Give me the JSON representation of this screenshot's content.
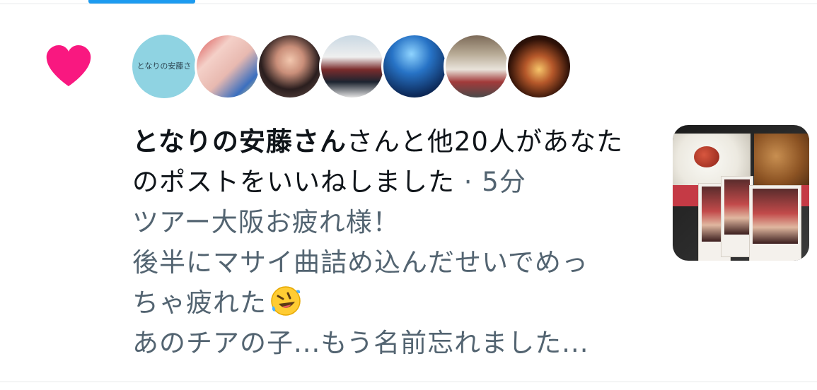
{
  "notification": {
    "name": "となりの安藤さん",
    "action_text": "さんと他20人があなたのポストをいいねしました",
    "separator": " · ",
    "time": "5分",
    "post_lines": [
      "ツアー大阪お疲れ様！",
      "後半にマサイ曲詰め込んだせいでめっ",
      "ちゃ疲れた",
      "あのチアの子...もう名前忘れました..."
    ],
    "emoji": "rolling-on-floor-laughing-emoji",
    "avatars": [
      {
        "label": "となりの安藤さ"
      },
      {
        "label": ""
      },
      {
        "label": ""
      },
      {
        "label": ""
      },
      {
        "label": ""
      },
      {
        "label": ""
      },
      {
        "label": ""
      }
    ]
  },
  "colors": {
    "heart": "#f91880",
    "accent": "#1d9bf0",
    "primary_text": "#0f1419",
    "secondary_text": "#536471"
  }
}
